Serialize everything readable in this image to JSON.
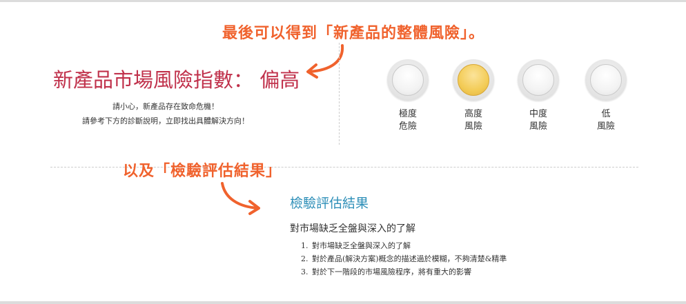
{
  "annotations": {
    "top": "最後可以得到「新產品的整體風險」。",
    "middle": "以及「檢驗評估結果」"
  },
  "risk": {
    "title": "新產品市場風險指數：  偏高",
    "warning_line1": "請小心，新產品存在致命危機！",
    "warning_line2": "請參考下方的診斷說明，立即找出具體解決方向！"
  },
  "levels": [
    {
      "line1": "極度",
      "line2": "危險",
      "active": false
    },
    {
      "line1": "高度",
      "line2": "風險",
      "active": true
    },
    {
      "line1": "中度",
      "line2": "風險",
      "active": false
    },
    {
      "line1": "低",
      "line2": "風險",
      "active": false
    }
  ],
  "result": {
    "heading": "檢驗評估結果",
    "subheading": "對市場缺乏全盤與深入的了解",
    "items": [
      {
        "num": "1.",
        "text": "對市場缺乏全盤與深入的了解"
      },
      {
        "num": "2.",
        "text": "對於產品(解決方案)概念的描述過於模糊，不夠清楚&精準"
      },
      {
        "num": "3.",
        "text": "對於下一階段的市場風險程序，將有重大的影響"
      }
    ]
  },
  "colors": {
    "annotation": "#f0622d",
    "risk_title": "#c0314b",
    "result_heading": "#2e8fb8",
    "active_level": "#f3cc57"
  }
}
